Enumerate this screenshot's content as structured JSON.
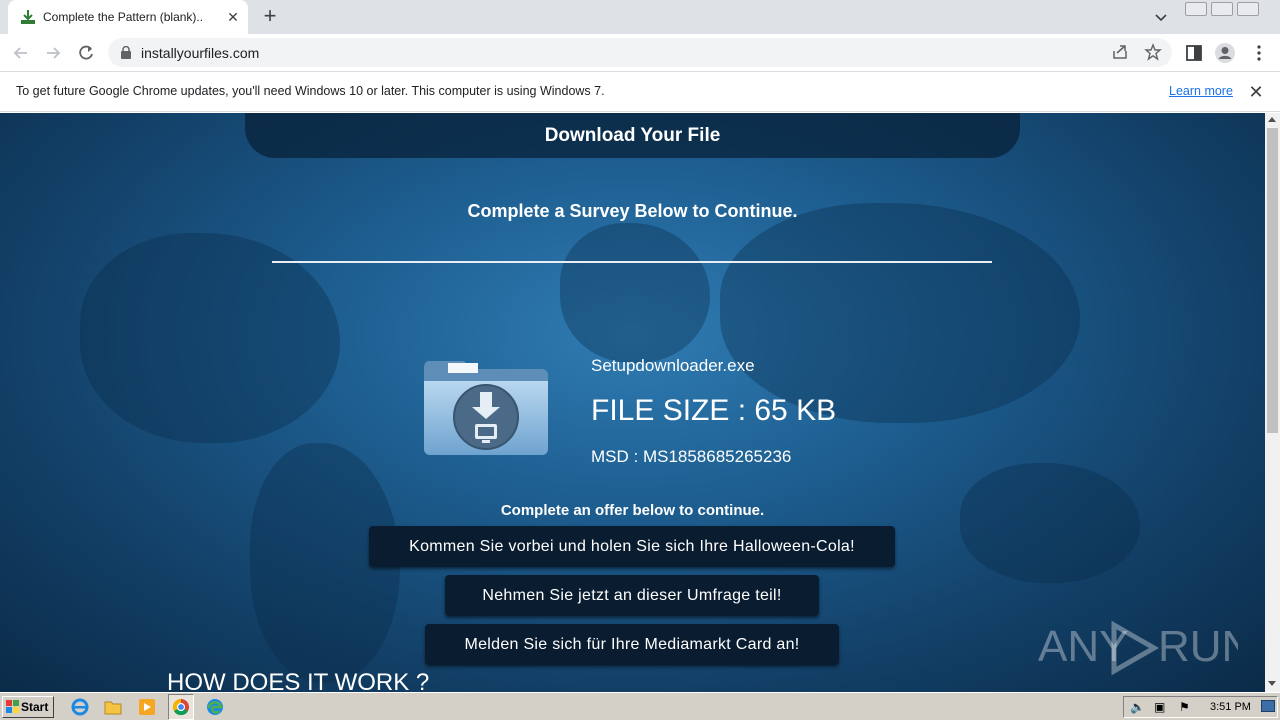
{
  "browser": {
    "tab_title": "Complete the Pattern (blank)..",
    "url": "installyourfiles.com"
  },
  "infobar": {
    "message": "To get future Google Chrome updates, you'll need Windows 10 or later. This computer is using Windows 7.",
    "link": "Learn more"
  },
  "page": {
    "title": "Download Your File",
    "survey_heading": "Complete a Survey Below to Continue.",
    "file_name": "Setupdownloader.exe",
    "file_size": "FILE SIZE : 65 KB",
    "msd": "MSD : MS1858685265236",
    "offer_prompt": "Complete an offer below to continue.",
    "offers": [
      "Kommen Sie vorbei und holen Sie sich Ihre Halloween-Cola!",
      "Nehmen Sie jetzt an dieser Umfrage teil!",
      "Melden Sie sich für Ihre Mediamarkt Card an!"
    ],
    "how_heading": "HOW DOES IT WORK ?",
    "watermark": "ANY RUN"
  },
  "taskbar": {
    "start_label": "Start",
    "clock": "3:51 PM"
  },
  "colors": {
    "page_bg": "#1d5d8f",
    "button_bg": "#0a1d30",
    "link": "#1a73e8"
  }
}
